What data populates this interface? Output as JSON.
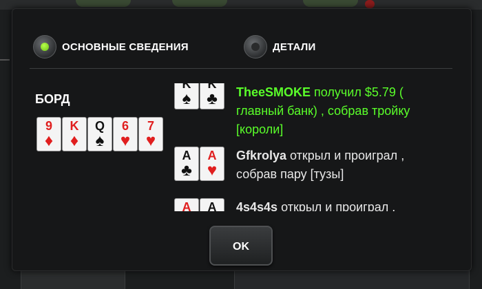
{
  "tabs": [
    {
      "label": "ОСНОВНЫЕ СВЕДЕНИЯ",
      "selected": true
    },
    {
      "label": "ДЕТАЛИ",
      "selected": false
    }
  ],
  "board": {
    "label": "БОРД",
    "cards": [
      {
        "rank": "9",
        "suit": "♦",
        "color": "red"
      },
      {
        "rank": "K",
        "suit": "♦",
        "color": "red"
      },
      {
        "rank": "Q",
        "suit": "♠",
        "color": "black"
      },
      {
        "rank": "6",
        "suit": "♥",
        "color": "red"
      },
      {
        "rank": "7",
        "suit": "♥",
        "color": "red"
      }
    ]
  },
  "history": [
    {
      "player": "TheeSMOKE",
      "text": " получил $5.79 ( главный банк) , собрав тройку [короли]",
      "winner": true,
      "cards": [
        {
          "rank": "K",
          "suit": "♠",
          "color": "black"
        },
        {
          "rank": "K",
          "suit": "♣",
          "color": "black"
        }
      ]
    },
    {
      "player": "Gfkrolya",
      "text": " открыл и проиграл , собрав пару [тузы]",
      "winner": false,
      "cards": [
        {
          "rank": "A",
          "suit": "♣",
          "color": "black"
        },
        {
          "rank": "A",
          "suit": "♥",
          "color": "red"
        }
      ]
    },
    {
      "player": "4s4s4s",
      "text": " открыл и проиграл , ",
      "winner": false,
      "cards": [
        {
          "rank": "A",
          "suit": "♦",
          "color": "red"
        },
        {
          "rank": "A",
          "suit": "♠",
          "color": "black"
        }
      ]
    }
  ],
  "ok_button": {
    "label": "OK"
  },
  "colors": {
    "win_text": "#5aff2a",
    "radio_on": "#8be02a",
    "red_suit": "#e01e1e"
  }
}
